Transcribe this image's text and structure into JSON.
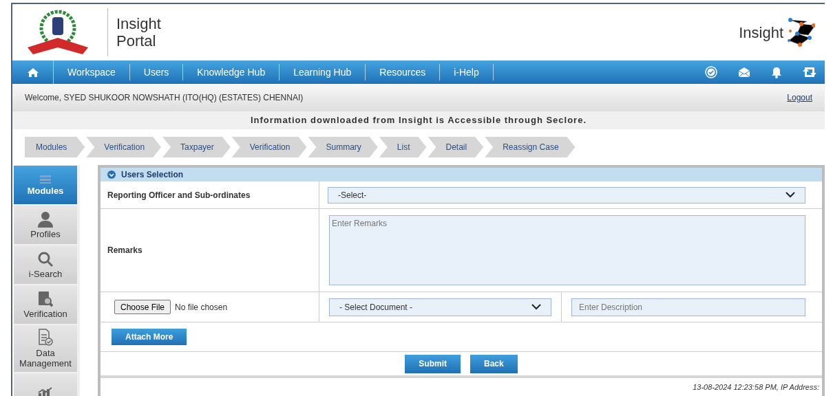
{
  "header": {
    "title": "Insight",
    "subtitle": "Portal",
    "brand": "Insight"
  },
  "nav": {
    "items": [
      {
        "label": "Workspace"
      },
      {
        "label": "Users"
      },
      {
        "label": "Knowledge Hub"
      },
      {
        "label": "Learning Hub"
      },
      {
        "label": "Resources"
      },
      {
        "label": "i-Help"
      }
    ]
  },
  "welcome": {
    "text": "Welcome, SYED SHUKOOR NOWSHATH (ITO(HQ) (ESTATES) CHENNAI)",
    "logout": "Logout"
  },
  "notice": "Information downloaded from Insight is Accessible through Seclore.",
  "breadcrumb": [
    "Modules",
    "Verification",
    "Taxpayer",
    "Verification",
    "Summary",
    "List",
    "Detail",
    "Reassign Case"
  ],
  "sidebar": {
    "items": [
      {
        "label": "Modules",
        "kind": "menu",
        "selected": true
      },
      {
        "label": "Profiles",
        "kind": "person",
        "selected": false
      },
      {
        "label": "i-Search",
        "kind": "search",
        "selected": false
      },
      {
        "label": "Verification",
        "kind": "verify",
        "selected": false
      },
      {
        "label": "Data Management",
        "kind": "data",
        "selected": false
      },
      {
        "kind": "chart",
        "selected": false
      }
    ]
  },
  "panel": {
    "title": "Users Selection",
    "expanded": true,
    "officer_label": "Reporting Officer and Sub-ordinates",
    "officer_value": "-Select-",
    "remarks_label": "Remarks",
    "remarks_placeholder": "Enter Remarks",
    "file_button": "Choose File",
    "file_status": "No file chosen",
    "document_value": "- Select Document -",
    "description_placeholder": "Enter Description",
    "attach_button": "Attach More",
    "buttons": [
      "Submit",
      "Back"
    ]
  },
  "footer": "13-08-2024 12:23:58 PM, IP Address:"
}
